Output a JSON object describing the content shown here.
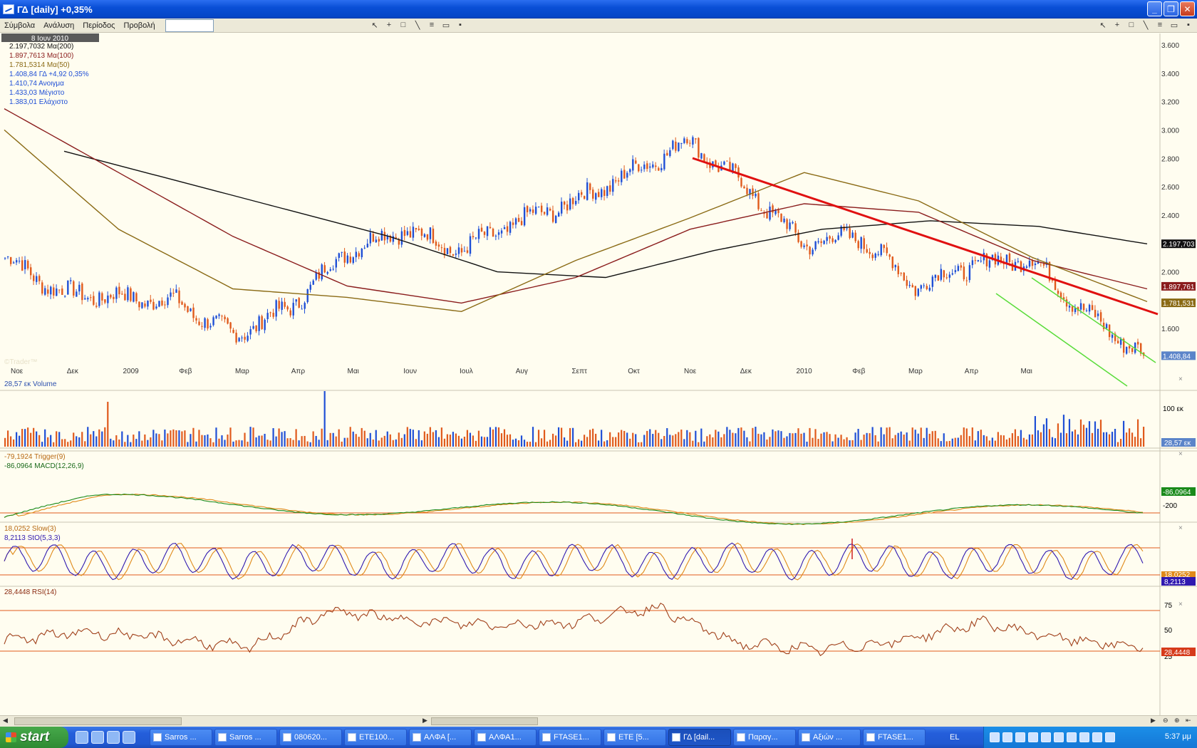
{
  "window": {
    "title": "ΓΔ [daily] +0,35%"
  },
  "menu": {
    "items": [
      "Σύμβολα",
      "Ανάλυση",
      "Περίοδος",
      "Προβολή"
    ]
  },
  "colors": {
    "up": "#1f4fd6",
    "down": "#e05a1c",
    "ma200": "#111111",
    "ma100": "#8a1c1c",
    "ma50": "#8a6a14",
    "trend_red": "#e01010",
    "channel_green": "#5adc3a",
    "grid_bg": "#fffdf0",
    "ref_line": "#d84a1a",
    "stoch_main": "#3019b0",
    "stoch_slow": "#e08a1a",
    "macd_line": "#1a8a1a",
    "trigger_line": "#e08a1a",
    "rsi_line": "#a0401a"
  },
  "price_panel": {
    "date_header": "8 Ιουν 2010",
    "legend": [
      {
        "text": "2.197,7032 Μα(200)",
        "color": "#111111"
      },
      {
        "text": "1.897,7613 Μα(100)",
        "color": "#8a1c1c"
      },
      {
        "text": "1.781,5314 Μα(50)",
        "color": "#8a6a14"
      },
      {
        "text": "1.408,84 ΓΔ +4,92 0,35%",
        "color": "#1f4fd6"
      },
      {
        "text": "1.410,74 Ανοιγμα",
        "color": "#1f4fd6"
      },
      {
        "text": "1.433,03 Μέγιστο",
        "color": "#1f4fd6"
      },
      {
        "text": "1.383,01 Ελάχιστο",
        "color": "#1f4fd6"
      }
    ],
    "watermark": "©Trader™",
    "y_ticks": [
      "3.600",
      "3.400",
      "3.200",
      "3.000",
      "2.800",
      "2.600",
      "2.400",
      "2.000",
      "1.600"
    ],
    "y_badges": [
      {
        "text": "2.197,703",
        "value": 2197.7,
        "bg": "#111111"
      },
      {
        "text": "1.897,761",
        "value": 1897.8,
        "bg": "#8a1c1c"
      },
      {
        "text": "1.781,531",
        "value": 1781.5,
        "bg": "#8a6a14"
      },
      {
        "text": "1.408,84",
        "value": 1408.8,
        "bg": "#5b84c9"
      }
    ],
    "x_labels": [
      "Νοε",
      "Δεκ",
      "2009",
      "Φεβ",
      "Μαρ",
      "Απρ",
      "Μαι",
      "Ιουν",
      "Ιουλ",
      "Αυγ",
      "Σεπτ",
      "Οκτ",
      "Νοε",
      "Δεκ",
      "2010",
      "Φεβ",
      "Μαρ",
      "Απρ",
      "Μαι"
    ]
  },
  "volume_panel": {
    "legend": "28,57 εκ Volume",
    "y_tick": "100 εκ",
    "badge": "28,57 εκ"
  },
  "macd_panel": {
    "legend_trigger": "-79,1924 Trigger(9)",
    "legend_macd": "-86,0964 MACD(12,26,9)",
    "y_tick": "-200",
    "badge": "-86,0964"
  },
  "stoch_panel": {
    "legend_slow": "18,0252 Slow(3)",
    "legend_sto": "8,2113 StO(5,3,3)",
    "badge": "8,2113",
    "badge_hidden": "18,0252"
  },
  "rsi_panel": {
    "legend": "28,4448 RSI(14)",
    "y_ticks": [
      "75",
      "50",
      "25"
    ],
    "badge": "28,4448"
  },
  "chart_data": {
    "type": "candlestick",
    "series": [
      {
        "name": "Μα(200)",
        "last": 2197.7032
      },
      {
        "name": "Μα(100)",
        "last": 1897.7613
      },
      {
        "name": "Μα(50)",
        "last": 1781.5314
      },
      {
        "name": "ΓΔ",
        "last": 1408.84,
        "open": 1410.74,
        "high": 1433.03,
        "low": 1383.01
      }
    ],
    "close_path": [
      {
        "x": "Νοε",
        "y": 2100
      },
      {
        "x": "Δεκ",
        "y": 1850
      },
      {
        "x": "2009",
        "y": 1820
      },
      {
        "x": "Φεβ",
        "y": 1790
      },
      {
        "x": "Μαρ",
        "y": 1550
      },
      {
        "x": "Απρ",
        "y": 1750
      },
      {
        "x": "Μαι",
        "y": 2150
      },
      {
        "x": "Ιουν",
        "y": 2300
      },
      {
        "x": "Ιουλ",
        "y": 2150
      },
      {
        "x": "Αυγ",
        "y": 2350
      },
      {
        "x": "Σεπτ",
        "y": 2500
      },
      {
        "x": "Οκτ",
        "y": 2700
      },
      {
        "x": "Οκτ",
        "y": 2930
      },
      {
        "x": "Νοε",
        "y": 2600
      },
      {
        "x": "Δεκ",
        "y": 2200
      },
      {
        "x": "2010",
        "y": 2250
      },
      {
        "x": "Φεβ",
        "y": 1900
      },
      {
        "x": "Μαρ",
        "y": 2050
      },
      {
        "x": "Απρ",
        "y": 2100
      },
      {
        "x": "Μαι",
        "y": 1700
      },
      {
        "x": "Μαι",
        "y": 1409
      }
    ],
    "ylim": [
      1400,
      3650
    ],
    "ma200_path": [
      2600,
      2450,
      2250,
      2050,
      1950,
      1960,
      2150,
      2300,
      2360,
      2320,
      2197
    ],
    "ma100_path": [
      2200,
      1850,
      1750,
      1720,
      1800,
      1960,
      2300,
      2520,
      2450,
      2100,
      1898
    ],
    "ma50_path": [
      1900,
      1750,
      1700,
      1800,
      2150,
      2350,
      2700,
      2480,
      2100,
      2000,
      1782
    ]
  },
  "taskbar": {
    "start_label": "start",
    "tasks": [
      {
        "label": "Sarros ...",
        "active": false
      },
      {
        "label": "Sarros ...",
        "active": false
      },
      {
        "label": "080620...",
        "active": false
      },
      {
        "label": "ETE100...",
        "active": false
      },
      {
        "label": "ΑΛΦΑ [...",
        "active": false
      },
      {
        "label": "ΑΛΦΑ1...",
        "active": false
      },
      {
        "label": "FTASE1...",
        "active": false
      },
      {
        "label": "ETE [5...",
        "active": false
      },
      {
        "label": "ΓΔ [dail...",
        "active": true
      },
      {
        "label": "Παραγ...",
        "active": false
      },
      {
        "label": "Αξιών ...",
        "active": false
      },
      {
        "label": "FTASE1...",
        "active": false
      }
    ],
    "lang": "EL",
    "clock": "5:37 μμ"
  }
}
